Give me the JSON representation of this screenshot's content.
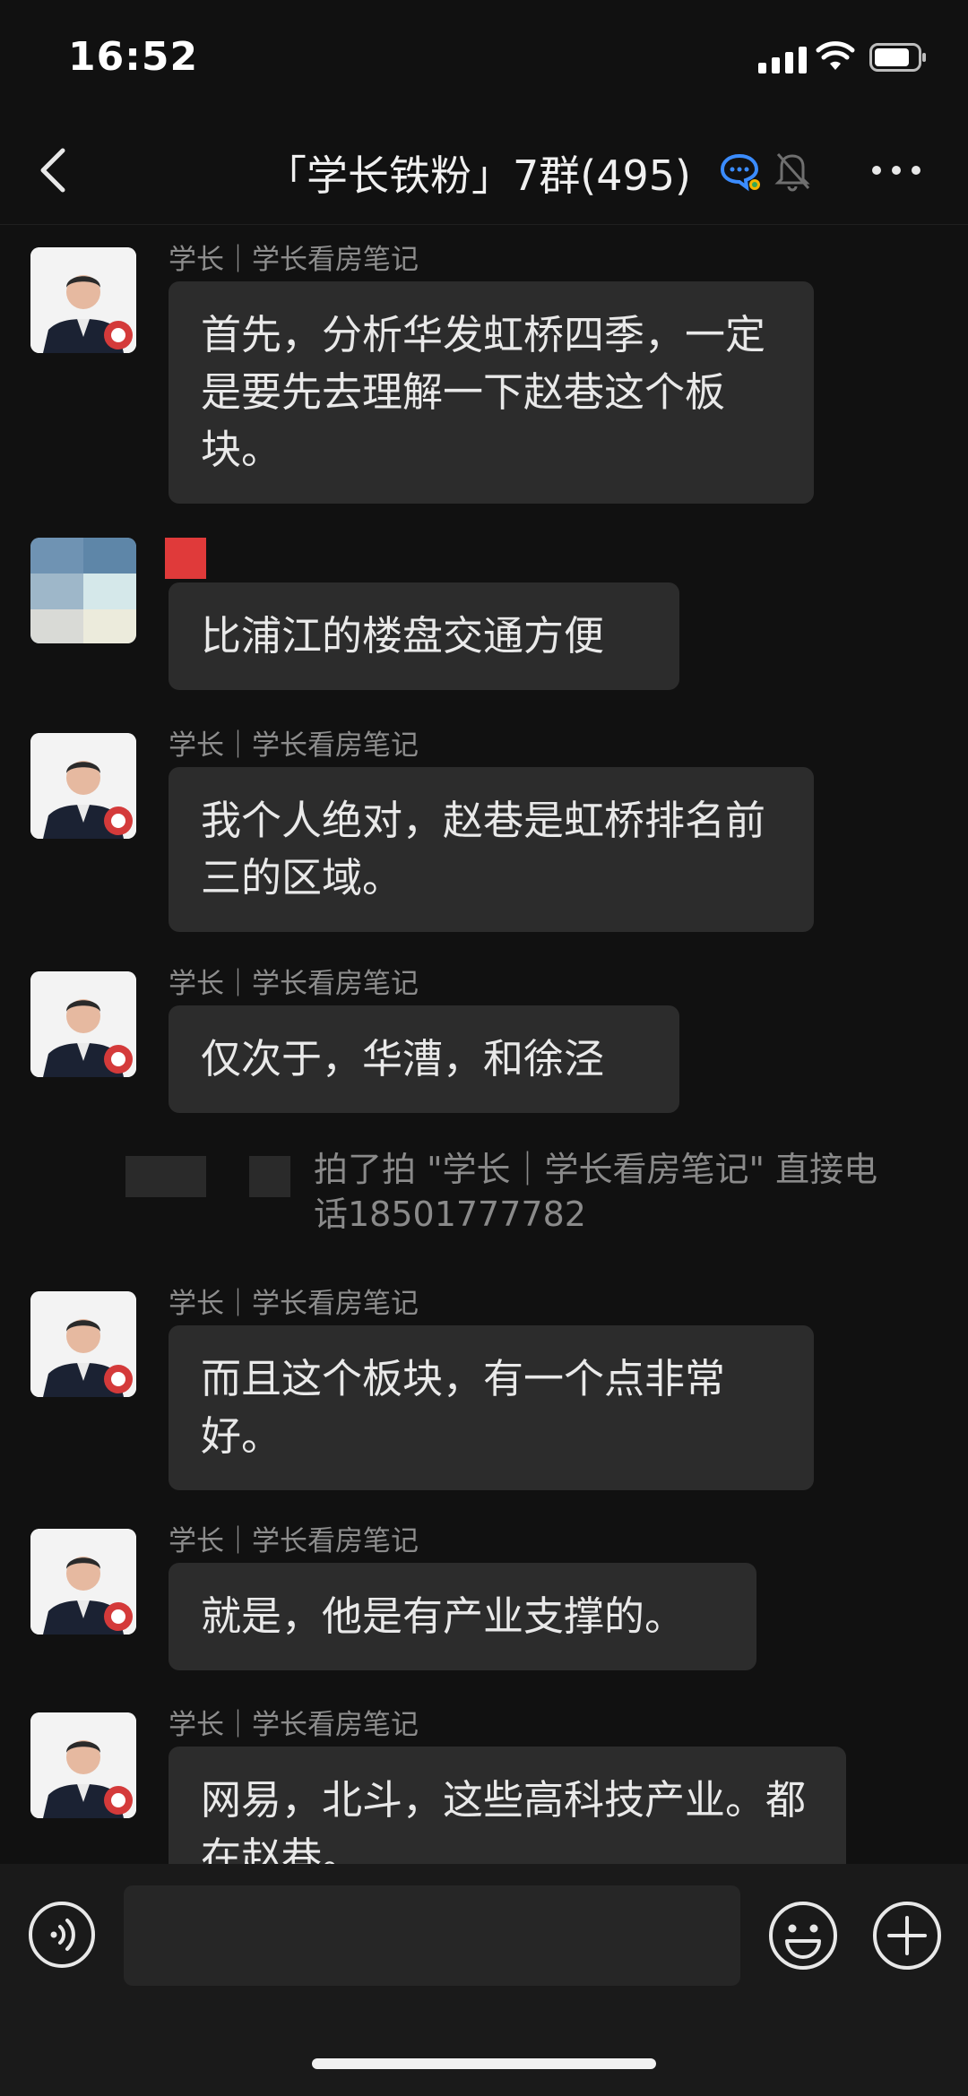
{
  "status": {
    "time": "16:52"
  },
  "nav": {
    "title": "「学长铁粉」7群(495)"
  },
  "messages": [
    {
      "sender": "学长｜学长看房笔记",
      "text": "首先，分析华发虹桥四季，一定是要先去理解一下赵巷这个板块。"
    },
    {
      "sender": "",
      "text": "比浦江的楼盘交通方便"
    },
    {
      "sender": "学长｜学长看房笔记",
      "text": "我个人绝对，赵巷是虹桥排名前三的区域。"
    },
    {
      "sender": "学长｜学长看房笔记",
      "text": "仅次于，华漕，和徐泾"
    },
    {
      "sender": "学长｜学长看房笔记",
      "text": "而且这个板块，有一个点非常好。"
    },
    {
      "sender": "学长｜学长看房笔记",
      "text": "就是，他是有产业支撑的。"
    },
    {
      "sender": "学长｜学长看房笔记",
      "text": "网易，北斗，这些高科技产业。都在赵巷。"
    }
  ],
  "system": {
    "text": "拍了拍 \"学长｜学长看房笔记\" 直接电话18501777782"
  },
  "input": {
    "placeholder": ""
  },
  "colors": {
    "background": "#111111",
    "bubble": "#2c2c2c",
    "input_bar": "#1a1a1a"
  }
}
